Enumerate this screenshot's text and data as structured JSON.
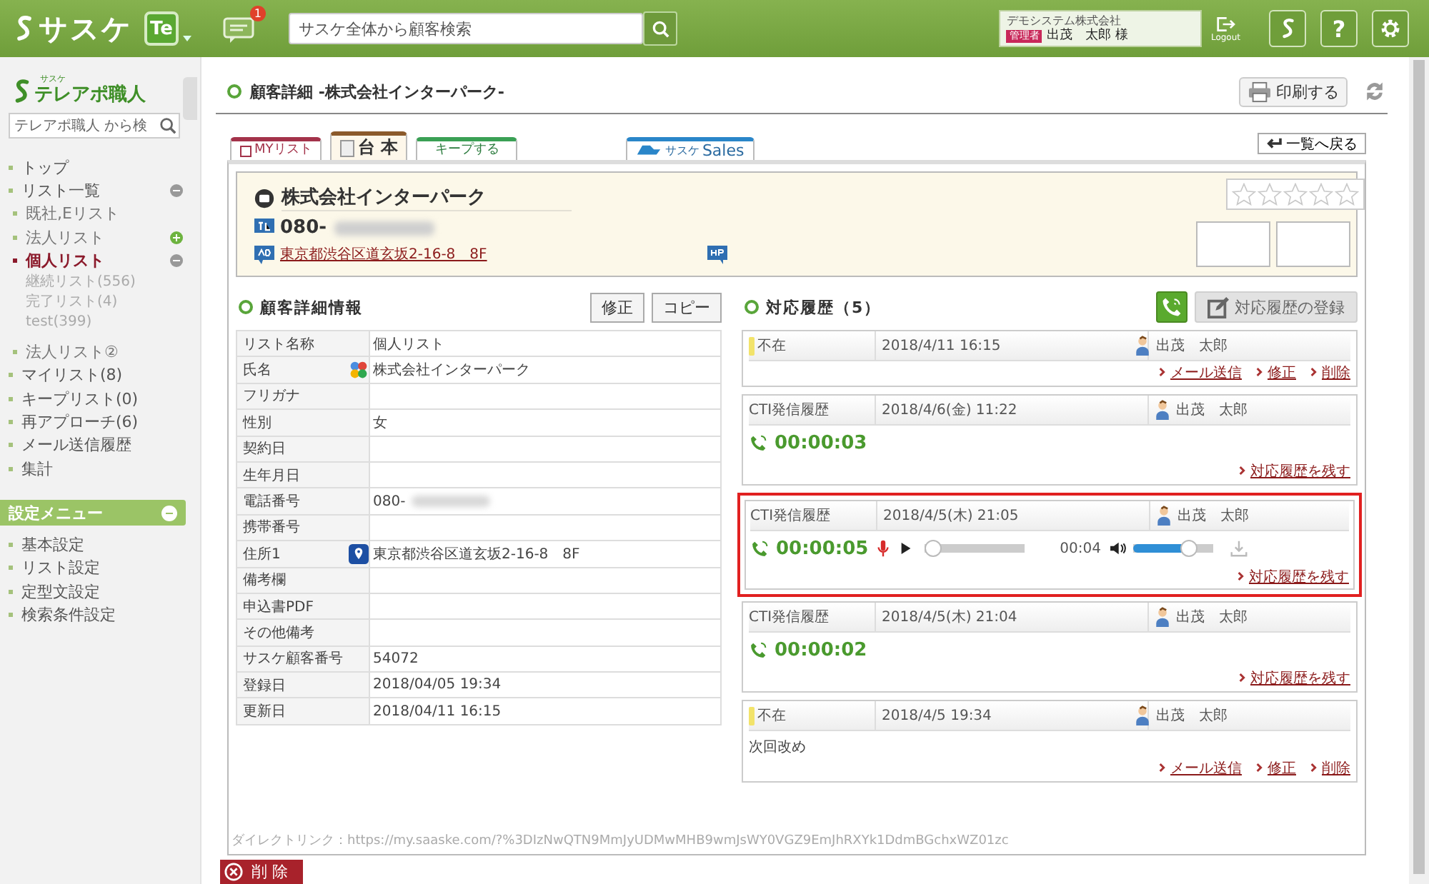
{
  "topbar": {
    "logo": "サスケ",
    "app_badge": "Te",
    "notification_count": "1",
    "search": {
      "placeholder": "サスケ全体から顧客検索"
    },
    "account": {
      "company": "デモシステム株式会社",
      "role": "管理者",
      "user": "出茂　太郎 様"
    },
    "logout": "Logout",
    "help": "?"
  },
  "sidebar": {
    "brand_small": "サスケ",
    "brand": "テレアポ職人",
    "search": {
      "placeholder": "テレアポ職人 から検"
    },
    "items": [
      {
        "label": "トップ",
        "selected": false
      },
      {
        "label": "リスト一覧",
        "selected": false,
        "expanded": true,
        "children": [
          {
            "label": "既社,Eリスト",
            "selected": false
          },
          {
            "label": "法人リスト",
            "selected": false,
            "expanded": false
          },
          {
            "label": "個人リスト",
            "selected": true,
            "expanded": true,
            "children": [
              {
                "label": "継続リスト(556)",
                "selected": false
              },
              {
                "label": "完了リスト(4)",
                "selected": false
              },
              {
                "label": "test(399)",
                "selected": false
              }
            ]
          },
          {
            "label": "法人リスト②",
            "selected": false
          }
        ]
      },
      {
        "label": "マイリスト(8)",
        "selected": false
      },
      {
        "label": "キープリスト(0)",
        "selected": false
      },
      {
        "label": "再アプローチ(6)",
        "selected": false
      },
      {
        "label": "メール送信履歴",
        "selected": false
      },
      {
        "label": "集計",
        "selected": false
      }
    ],
    "settings": {
      "title": "設定メニュー",
      "expanded": true,
      "items": [
        {
          "label": "基本設定",
          "selected": false
        },
        {
          "label": "リスト設定",
          "selected": false
        },
        {
          "label": "定型文設定",
          "selected": false
        },
        {
          "label": "検索条件設定",
          "selected": false
        }
      ]
    }
  },
  "page": {
    "title": "顧客詳細 -株式会社インターパーク-",
    "print": "印刷する",
    "back": "一覧へ戻る",
    "tabs": [
      {
        "label": "MYリスト",
        "kind": "mylist",
        "selected": false
      },
      {
        "label": "台 本",
        "kind": "script",
        "selected": true
      },
      {
        "label": "キープする",
        "kind": "keep",
        "selected": false
      },
      {
        "label": "Sales",
        "prefix": "サスケ",
        "kind": "sales",
        "selected": false
      }
    ],
    "card": {
      "name": "株式会社インターパーク",
      "tel": "080-",
      "redacted": true,
      "address": "東京都渋谷区道玄坂2-16-8　8F",
      "stars": 0
    },
    "details": {
      "title": "顧客詳細情報",
      "buttons": [
        "修正",
        "コピー"
      ],
      "rows": [
        {
          "kind": "text",
          "label": "リスト名称",
          "value": "個人リスト"
        },
        {
          "kind": "contacts",
          "label": "氏名",
          "value": "株式会社インターパーク"
        },
        {
          "kind": "text",
          "label": "フリガナ"
        },
        {
          "kind": "text",
          "label": "性別",
          "value": "女"
        },
        {
          "kind": "text",
          "label": "契約日"
        },
        {
          "kind": "text",
          "label": "生年月日"
        },
        {
          "kind": "text",
          "label": "電話番号",
          "value": "080-",
          "redacted": true
        },
        {
          "kind": "text",
          "label": "携帯番号"
        },
        {
          "kind": "map",
          "label": "住所1",
          "value": "東京都渋谷区道玄坂2-16-8　8F"
        },
        {
          "kind": "text",
          "label": "備考欄"
        },
        {
          "kind": "text",
          "label": "申込書PDF"
        },
        {
          "kind": "text",
          "label": "その他備考"
        },
        {
          "kind": "text",
          "label": "サスケ顧客番号",
          "value": "54072"
        },
        {
          "kind": "text",
          "label": "登録日",
          "value": "2018/04/05 19:34"
        },
        {
          "kind": "text",
          "label": "更新日",
          "value": "2018/04/11 16:15"
        }
      ]
    },
    "history": {
      "title": "対応履歴（5）",
      "register": "対応履歴の登録",
      "entries": [
        {
          "kind": "status",
          "label": "不在",
          "color": "#f2e36a",
          "date": "2018/4/11 16:15",
          "user": "出茂　太郎",
          "links": [
            "メール送信",
            "修正",
            "削除"
          ],
          "highlighted": false
        },
        {
          "kind": "call",
          "label": "CTI発信履歴",
          "date": "2018/4/6(金) 11:22",
          "user": "出茂　太郎",
          "duration": "00:00:03",
          "links": [
            "対応履歴を残す"
          ],
          "highlighted": false
        },
        {
          "kind": "call",
          "label": "CTI発信履歴",
          "date": "2018/4/5(木) 21:05",
          "user": "出茂　太郎",
          "duration": "00:00:05",
          "player": {
            "progress": {
              "level": 0
            },
            "time": "00:04",
            "volume": {
              "level": 0.72
            }
          },
          "links": [
            "対応履歴を残す"
          ],
          "highlighted": true
        },
        {
          "kind": "call",
          "label": "CTI発信履歴",
          "date": "2018/4/5(木) 21:04",
          "user": "出茂　太郎",
          "duration": "00:00:02",
          "links": [
            "対応履歴を残す"
          ],
          "highlighted": false
        },
        {
          "kind": "status",
          "label": "不在",
          "color": "#f2e36a",
          "date": "2018/4/5 19:34",
          "user": "出茂　太郎",
          "note": "次回改め",
          "links": [
            "メール送信",
            "修正",
            "削除"
          ],
          "highlighted": false
        }
      ]
    },
    "direct_link": "ダイレクトリンク：https://my.saaske.com/?%3DIzNwQTN9MmJyUDMwMHB9wmJsWY0VGZ9EmJhRXYk1DdmBGchxWZ01zc",
    "delete": "削 除"
  }
}
